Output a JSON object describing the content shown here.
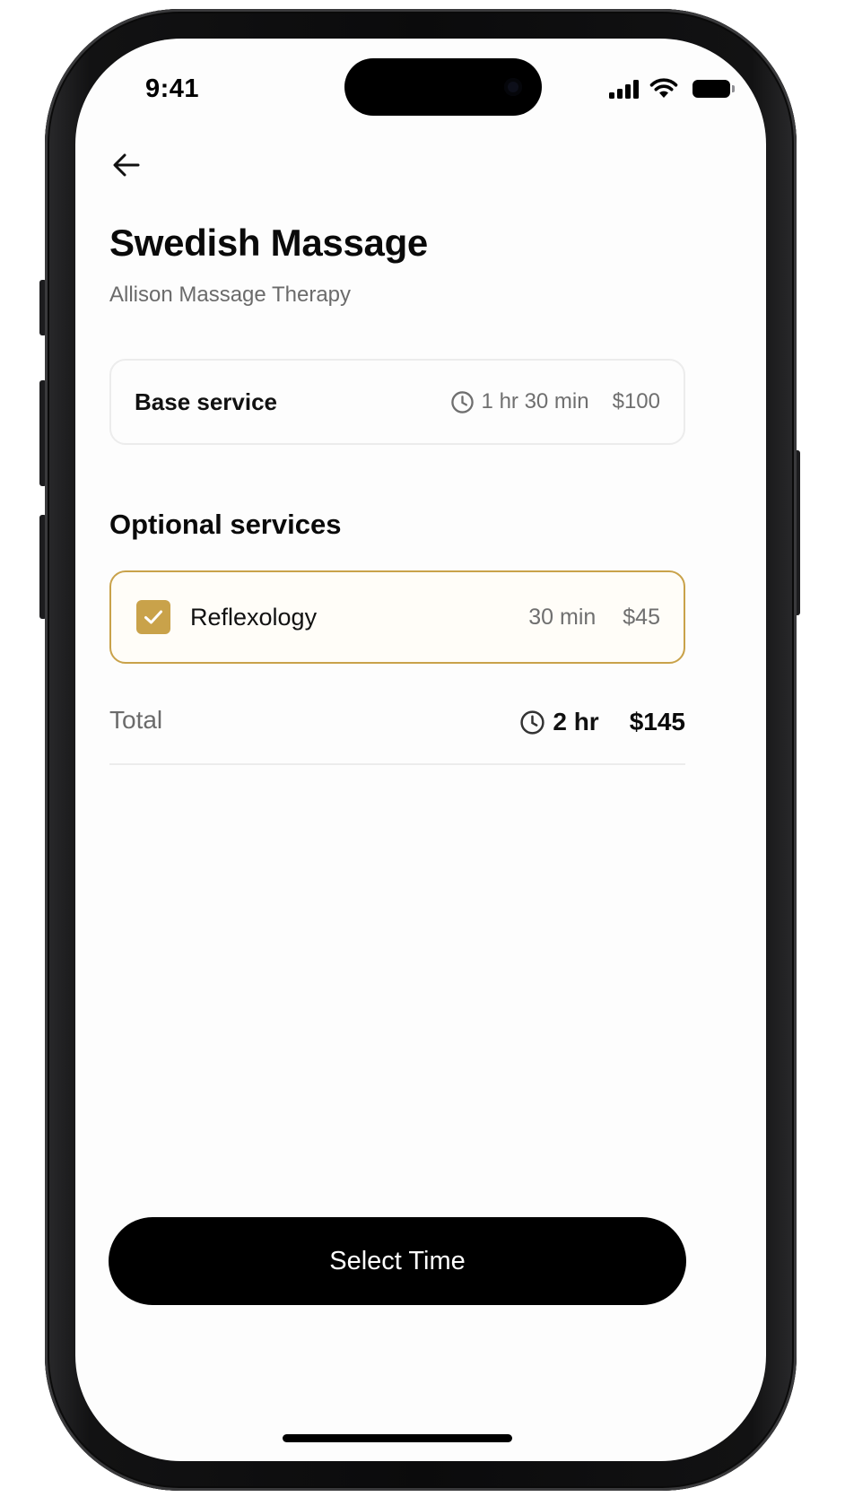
{
  "status_bar": {
    "time": "9:41",
    "icons": [
      "cellular-signal-icon",
      "wifi-icon",
      "battery-icon"
    ]
  },
  "nav": {
    "back_icon": "arrow-left-icon"
  },
  "header": {
    "title": "Swedish Massage",
    "subtitle": "Allison Massage Therapy"
  },
  "base_service": {
    "label": "Base service",
    "duration": "1 hr 30 min",
    "price": "$100",
    "icon": "clock-icon"
  },
  "optional_services": {
    "heading": "Optional services",
    "items": [
      {
        "label": "Reflexology",
        "duration": "30 min",
        "price": "$45",
        "checked": true
      }
    ]
  },
  "total": {
    "label": "Total",
    "duration": "2 hr",
    "price": "$145",
    "icon": "clock-icon"
  },
  "cta": {
    "label": "Select Time"
  },
  "colors": {
    "accent": "#c9a24a",
    "text": "#0a0a0a",
    "muted": "#6f6f6f",
    "button": "#000000"
  }
}
